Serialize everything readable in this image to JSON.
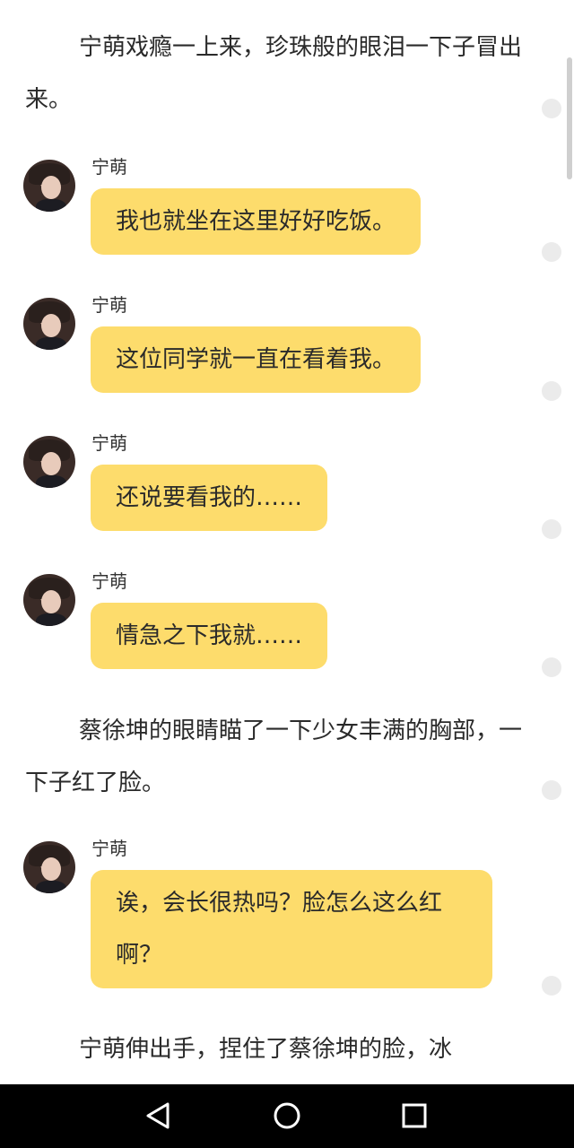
{
  "narration": [
    "宁萌戏瘾一上来，珍珠般的眼泪一下子冒出来。",
    "蔡徐坤的眼睛瞄了一下少女丰满的胸部，一下子红了脸。",
    "宁萌伸出手，捏住了蔡徐坤的脸，冰"
  ],
  "messages": [
    {
      "sender": "宁萌",
      "text": "我也就坐在这里好好吃饭。"
    },
    {
      "sender": "宁萌",
      "text": "这位同学就一直在看着我。"
    },
    {
      "sender": "宁萌",
      "text": "还说要看我的……"
    },
    {
      "sender": "宁萌",
      "text": "情急之下我就……"
    },
    {
      "sender": "宁萌",
      "text": "诶，会长很热吗？脸怎么这么红啊？"
    }
  ],
  "colors": {
    "bubble": "#fddc6c",
    "navbar": "#000000"
  },
  "navbar": {
    "icons": [
      "back-triangle-icon",
      "home-circle-icon",
      "recent-square-icon"
    ]
  }
}
